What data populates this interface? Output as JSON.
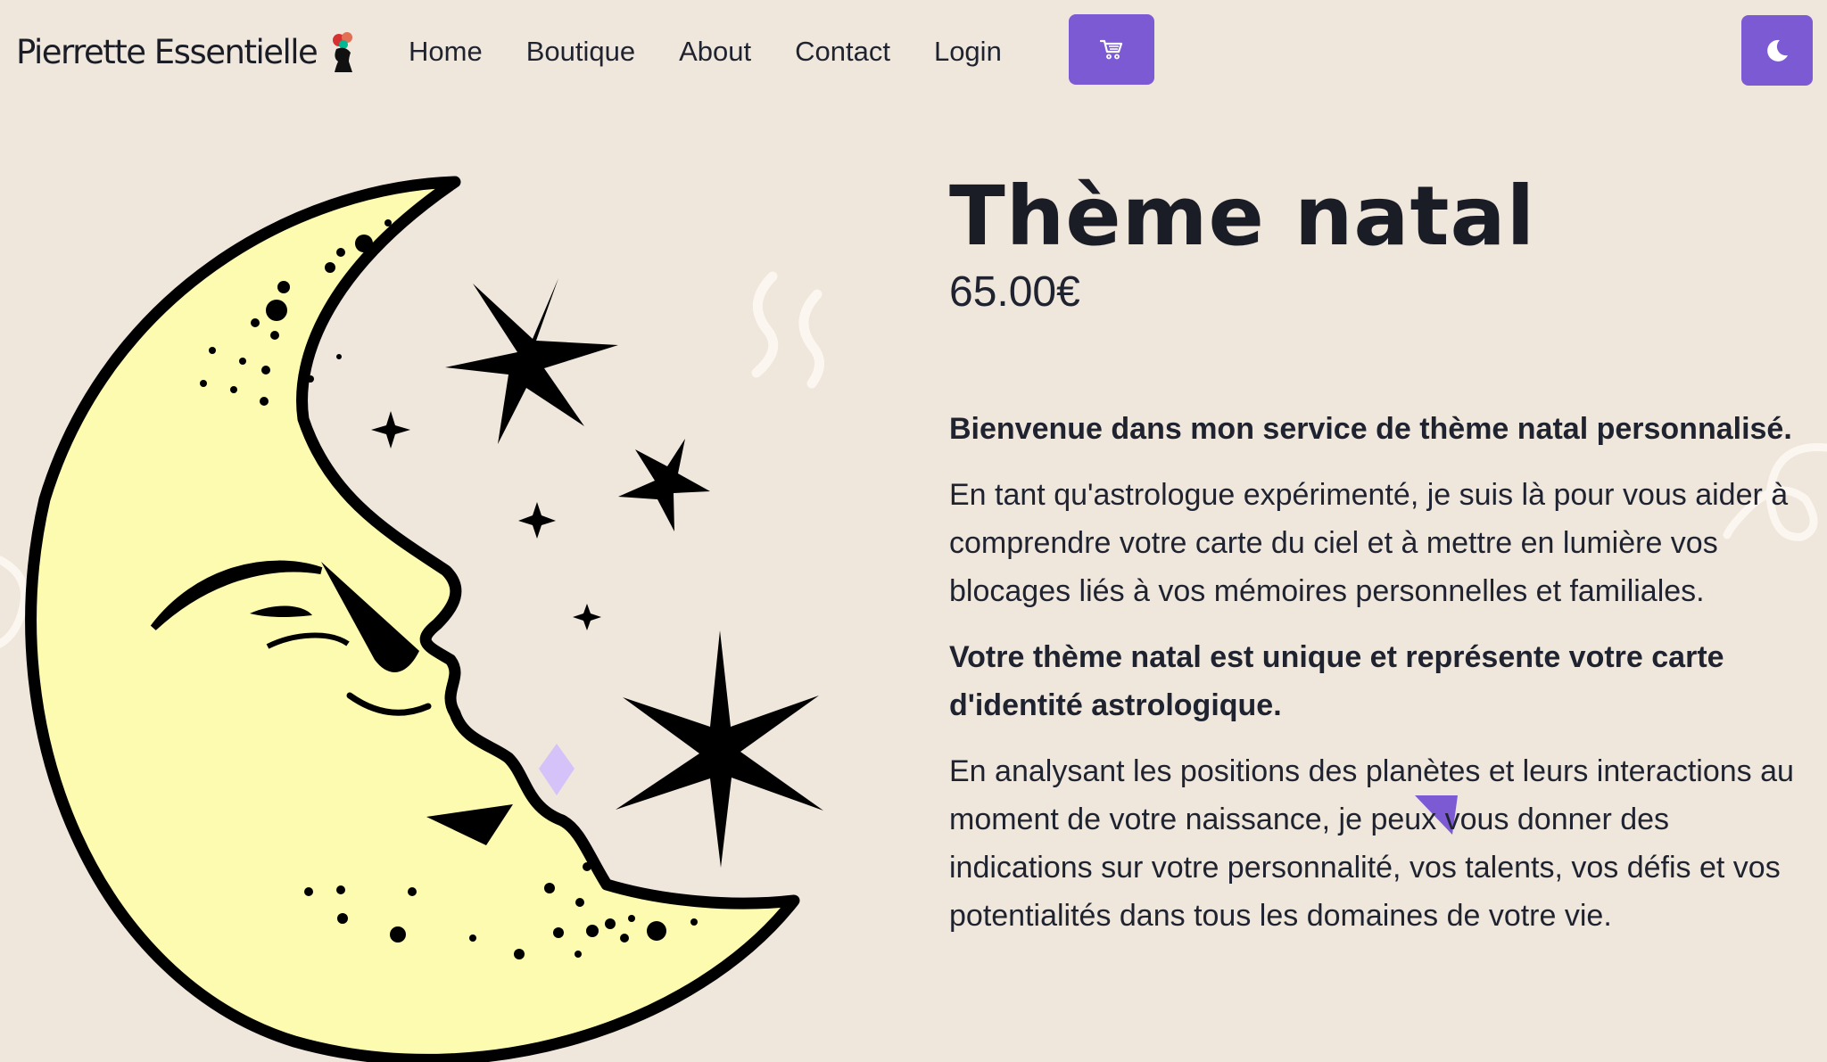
{
  "brand": {
    "name": "Pierrette Essentielle"
  },
  "nav": {
    "links": [
      "Home",
      "Boutique",
      "About",
      "Contact",
      "Login"
    ],
    "cart_icon": "cart-icon",
    "theme_icon": "moon-icon"
  },
  "product": {
    "title": "Thème natal",
    "price": "65.00€",
    "paragraphs": [
      "Bienvenue dans mon service de thème natal personnalisé.",
      "En tant qu'astrologue expérimenté, je suis là pour vous aider à comprendre votre carte du ciel et à mettre en lumière vos blocages liés à vos mémoires personnelles et familiales.",
      "Votre thème natal est unique et représente votre carte d'identité astrologique.",
      "En analysant les positions des planètes et leurs interactions au moment de votre naissance, je peux vous donner des indications sur votre personnalité, vos talents, vos défis et vos potentialités dans tous les domaines de votre vie."
    ]
  },
  "colors": {
    "background": "#efe6dc",
    "accent": "#7c5ad4",
    "moon_fill": "#fdfbb0",
    "text": "#1f2330"
  }
}
